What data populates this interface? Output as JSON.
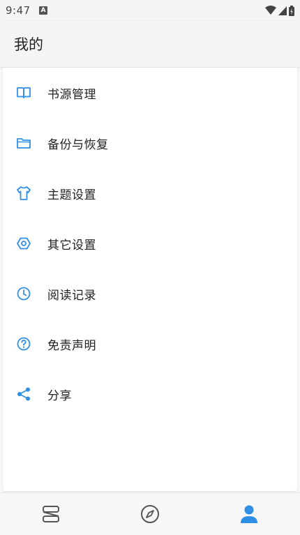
{
  "status_bar": {
    "time": "9:47",
    "notification_badge": "A"
  },
  "app_bar": {
    "title": "我的"
  },
  "menu": {
    "items": [
      {
        "label": "书源管理",
        "icon": "book-open-icon"
      },
      {
        "label": "备份与恢复",
        "icon": "folder-icon"
      },
      {
        "label": "主题设置",
        "icon": "shirt-icon"
      },
      {
        "label": "其它设置",
        "icon": "hexagon-settings-icon"
      },
      {
        "label": "阅读记录",
        "icon": "clock-icon"
      },
      {
        "label": "免责声明",
        "icon": "help-circle-icon"
      },
      {
        "label": "分享",
        "icon": "share-icon"
      }
    ]
  },
  "bottom_nav": {
    "items": [
      {
        "name": "bookshelf",
        "icon": "bookshelf-icon",
        "active": false
      },
      {
        "name": "discover",
        "icon": "compass-icon",
        "active": false
      },
      {
        "name": "profile",
        "icon": "person-icon",
        "active": true
      }
    ]
  },
  "colors": {
    "accent": "#2f8ee5",
    "inactive": "#555555",
    "text": "#222222"
  }
}
